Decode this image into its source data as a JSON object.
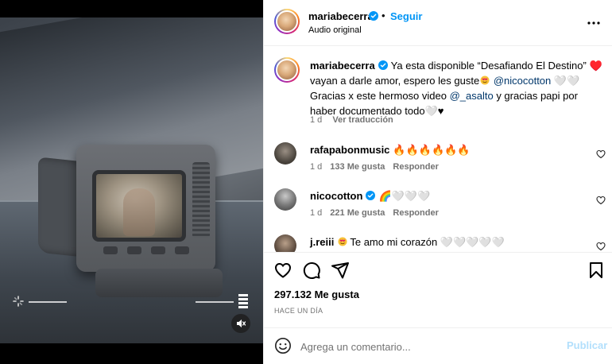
{
  "post": {
    "author": "mariabecerra",
    "follow_label": "Seguir",
    "separator": "•",
    "audio_label": "Audio original"
  },
  "caption": {
    "username": "mariabecerra",
    "text_1": "Ya esta disponible “Desafiando El Destino” ♥️",
    "text_2": " vayan a darle amor, espero les guste",
    "mention_1": "@nicocotton",
    "text_3": " 🤍🤍 Gracias x este hermoso video ",
    "mention_2": "@_asalto",
    "text_4": " y gracias papi por haber documentado todo🤍♥",
    "age": "1 d",
    "translate_label": "Ver traducción"
  },
  "comments": [
    {
      "username": "rafapabonmusic",
      "text": "🔥🔥🔥🔥🔥🔥",
      "age": "1 d",
      "likes": "133 Me gusta",
      "reply": "Responder"
    },
    {
      "username": "nicocotton",
      "text": "🌈🤍🤍🤍",
      "age": "1 d",
      "likes": "221 Me gusta",
      "reply": "Responder"
    },
    {
      "username": "j.reiii",
      "text": "Te amo mi corazón 🤍🤍🤍🤍🤍"
    }
  ],
  "engagement": {
    "likes": "297.132 Me gusta",
    "time": "HACE UN DÍA"
  },
  "composer": {
    "placeholder": "Agrega un comentario...",
    "publish_label": "Publicar"
  },
  "icons": {
    "verified": "verified-badge-icon",
    "more": "more-options-icon",
    "like": "heart-icon",
    "comment": "comment-icon",
    "share": "share-icon",
    "save": "bookmark-icon",
    "emoji": "emoji-icon",
    "mute": "muted-speaker-icon"
  },
  "colors": {
    "accent": "#0095f6",
    "publish_disabled": "#b2dffc",
    "muted_text": "#737373",
    "mention": "#00376b",
    "verified": "#0095f6"
  }
}
